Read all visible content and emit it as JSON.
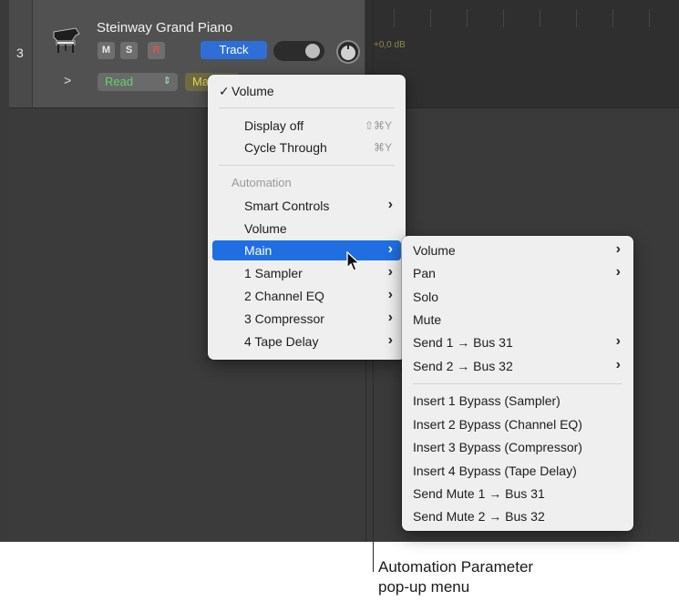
{
  "track": {
    "number": "3",
    "name": "Steinway Grand Piano",
    "mute_label": "M",
    "solo_label": "S",
    "record_label": "R",
    "track_button_label": "Track",
    "automation_mode": "Read",
    "automation_param": "Main",
    "region_gain": "+0,0 dB"
  },
  "menu1": {
    "items": [
      {
        "label": "Volume",
        "checked": "✓"
      },
      {
        "label": "Display off",
        "shortcut": "⇧⌘Y"
      },
      {
        "label": "Cycle Through",
        "shortcut": "⌘Y"
      },
      {
        "label": "Automation"
      },
      {
        "label": "Smart Controls",
        "chevron": "›"
      },
      {
        "label": "Volume"
      },
      {
        "label": "Main",
        "chevron": "›"
      },
      {
        "label": "1 Sampler",
        "chevron": "›"
      },
      {
        "label": "2 Channel EQ",
        "chevron": "›"
      },
      {
        "label": "3 Compressor",
        "chevron": "›"
      },
      {
        "label": "4 Tape Delay",
        "chevron": "›"
      }
    ]
  },
  "menu2": {
    "items": [
      {
        "label": "Volume",
        "chevron": "›"
      },
      {
        "label": "Pan",
        "chevron": "›"
      },
      {
        "label": "Solo"
      },
      {
        "label": "Mute"
      },
      {
        "label": "Send 1 → Bus 31",
        "chevron": "›"
      },
      {
        "label": "Send 2 → Bus 32",
        "chevron": "›"
      },
      {
        "label": "Insert 1 Bypass (Sampler)"
      },
      {
        "label": "Insert 2 Bypass (Channel EQ)"
      },
      {
        "label": "Insert 3 Bypass (Compressor)"
      },
      {
        "label": "Insert 4 Bypass (Tape Delay)"
      },
      {
        "label": "Send Mute 1 → Bus 31"
      },
      {
        "label": "Send Mute 2 → Bus 32"
      }
    ]
  },
  "callout": {
    "line1": "Automation Parameter",
    "line2": "pop-up menu"
  },
  "colors": {
    "selection": "#1f6fe3",
    "read_mode": "#62d36a",
    "main_param": "#e6d65a",
    "track_button": "#2d6fd6",
    "record": "#e0524a"
  }
}
